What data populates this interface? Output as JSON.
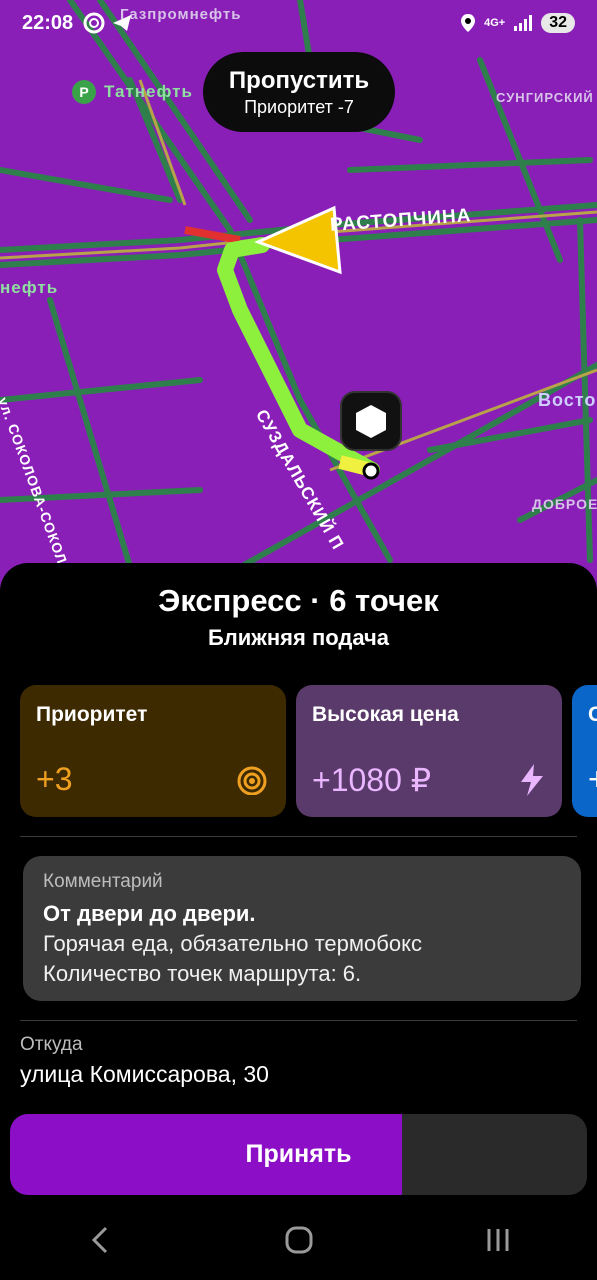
{
  "status_bar": {
    "time": "22:08",
    "network": "4G+",
    "battery": "32"
  },
  "map": {
    "labels": {
      "gazprom": "Газпромнефть",
      "tatneft": "Татнефть",
      "tatneft_left": "нефть",
      "sungirsky": "СУНГИРСКИЙ",
      "rastopchina": "РАСТОПЧИНА",
      "sokolova": "ул. СОКОЛОВА-СОКОЛЁНКА",
      "suzdalsky": "СУЗДАЛЬСКИЙ П",
      "vostok": "Восто",
      "dobroe": "ДОБРОЕ"
    },
    "colors": {
      "background": "#8a1fb8",
      "route": "#8cf03c",
      "traffic": "#2f8a4a"
    }
  },
  "skip": {
    "title": "Пропустить",
    "subtitle": "Приоритет -7"
  },
  "order": {
    "title": "Экспресс · 6 точек",
    "subtitle": "Ближняя подача"
  },
  "cards": [
    {
      "title": "Приоритет",
      "value": "+3",
      "icon": "priority-radio-icon",
      "color": "#3d2a00",
      "value_color": "#f0a020"
    },
    {
      "title": "Высокая цена",
      "value": "+1080 ₽",
      "icon": "lightning-icon",
      "color": "#5a3a6a",
      "value_color": "#e9b6ff"
    },
    {
      "title": "С",
      "value": "+",
      "icon": "",
      "color": "#0a66c9",
      "value_color": "#ffffff"
    }
  ],
  "comment": {
    "label": "Комментарий",
    "bold": "От двери до двери.",
    "line1": "Горячая еда, обязательно термобокс",
    "line2": "Количество точек маршрута: 6."
  },
  "from": {
    "label": "Откуда",
    "value": "улица Комиссарова, 30"
  },
  "accept": {
    "label": "Принять",
    "progress": 0.68,
    "color": "#8c0fc7"
  }
}
